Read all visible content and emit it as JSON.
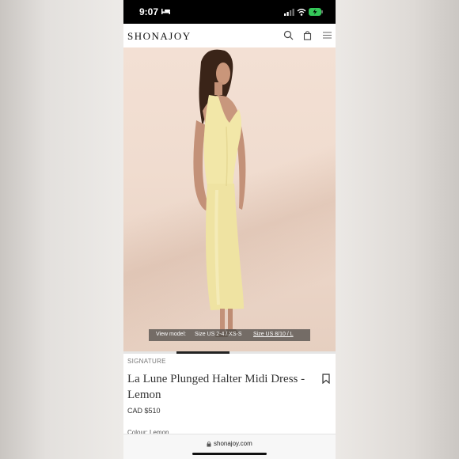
{
  "status_bar": {
    "time": "9:07"
  },
  "header": {
    "logo": "SHONAJOY"
  },
  "product_image": {
    "view_model_label": "View model:",
    "size_option_1": "Size US 2-4 / XS-S",
    "size_option_2": "Size US 8/10 / L"
  },
  "product": {
    "collection": "SIGNATURE",
    "title": "La Lune Plunged Halter Midi Dress - Lemon",
    "price": "CAD $510",
    "colour_label": "Colour: Lemon"
  },
  "browser": {
    "url": "shonajoy.com"
  },
  "icons": {
    "status": [
      "bed-icon",
      "signal-icon",
      "wifi-icon",
      "battery-icon"
    ],
    "header": [
      "search-icon",
      "bag-icon",
      "menu-icon"
    ],
    "product": [
      "bookmark-icon"
    ],
    "browser": [
      "lock-icon"
    ]
  },
  "colors": {
    "battery": "#34c759",
    "dress": "#f2e7a8",
    "backdrop": "#f0dccf"
  }
}
